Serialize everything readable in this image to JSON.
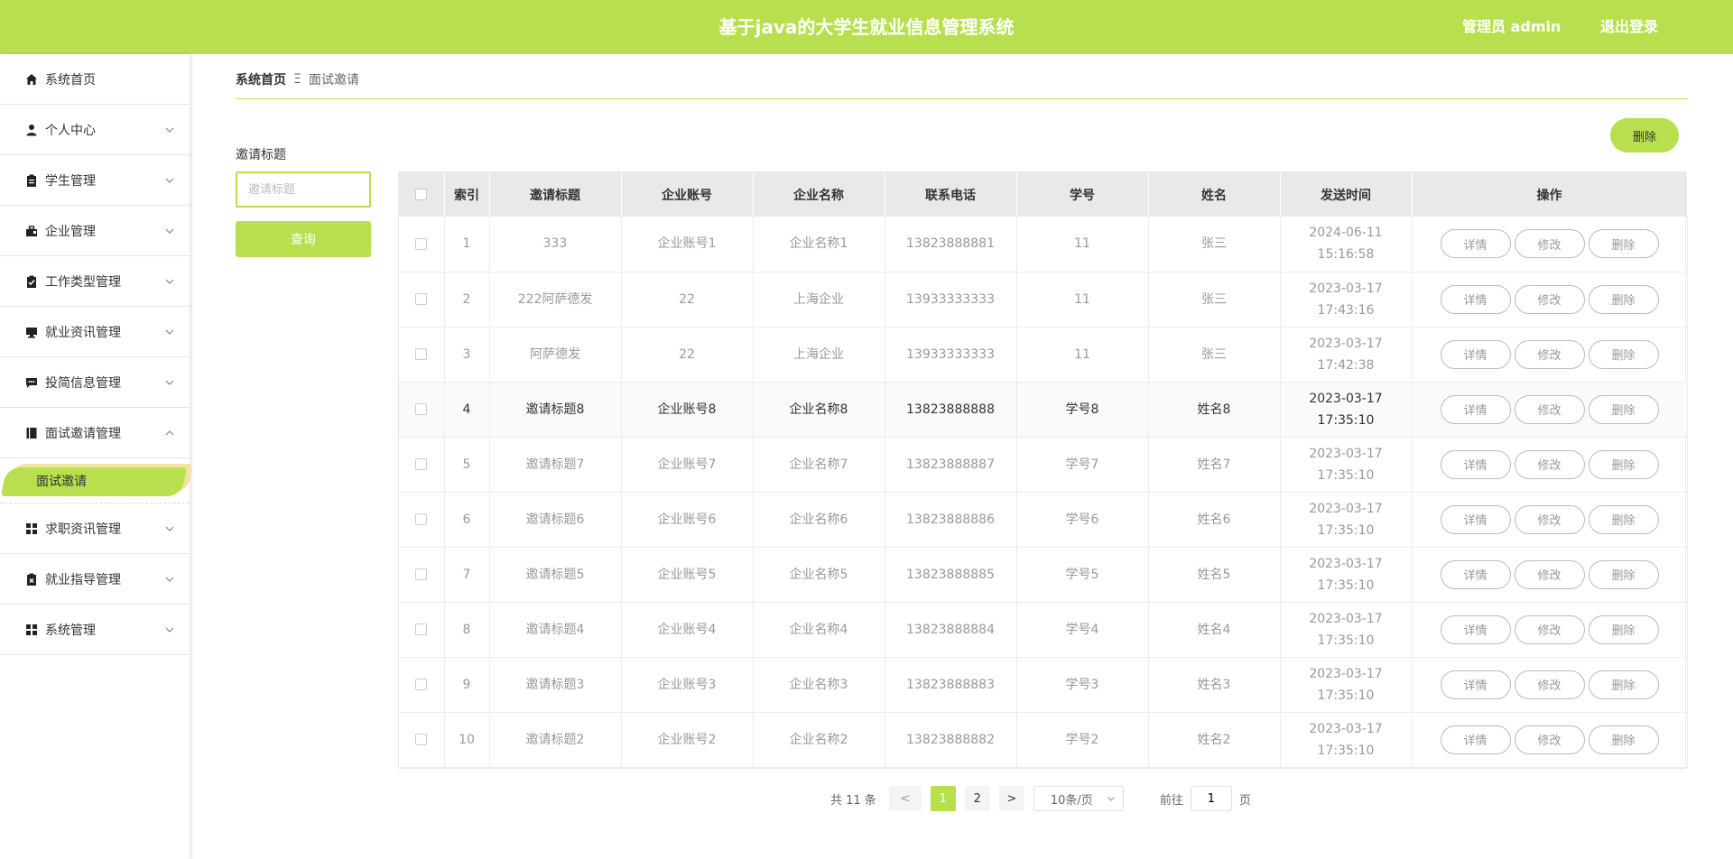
{
  "header": {
    "title": "基于java的大学生就业信息管理系统",
    "user": "管理员 admin",
    "logout": "退出登录"
  },
  "sidebar": {
    "items": [
      {
        "label": "系统首页",
        "icon": "home-icon"
      },
      {
        "label": "个人中心",
        "icon": "user-icon"
      },
      {
        "label": "学生管理",
        "icon": "clipboard-icon"
      },
      {
        "label": "企业管理",
        "icon": "briefcase-icon"
      },
      {
        "label": "工作类型管理",
        "icon": "checklist-icon"
      },
      {
        "label": "就业资讯管理",
        "icon": "monitor-icon"
      },
      {
        "label": "投简信息管理",
        "icon": "chat-icon"
      },
      {
        "label": "面试邀请管理",
        "icon": "book-icon"
      },
      {
        "label": "求职资讯管理",
        "icon": "grid-icon"
      },
      {
        "label": "就业指导管理",
        "icon": "clipboard-x-icon"
      },
      {
        "label": "系统管理",
        "icon": "grid-icon"
      }
    ],
    "active_sub": "面试邀请"
  },
  "breadcrumb": {
    "home": "系统首页",
    "sep": "Ξ",
    "current": "面试邀请"
  },
  "filter": {
    "label": "邀请标题",
    "placeholder": "邀请标题",
    "query": "查询"
  },
  "actions": {
    "delete": "删除"
  },
  "table": {
    "headers": [
      "索引",
      "邀请标题",
      "企业账号",
      "企业名称",
      "联系电话",
      "学号",
      "姓名",
      "发送时间",
      "操作"
    ],
    "op_labels": [
      "详情",
      "修改",
      "删除"
    ],
    "rows": [
      [
        "1",
        "333",
        "企业账号1",
        "企业名称1",
        "13823888881",
        "11",
        "张三",
        "2024-06-11 15:16:58"
      ],
      [
        "2",
        "222阿萨德发",
        "22",
        "上海企业",
        "13933333333",
        "11",
        "张三",
        "2023-03-17 17:43:16"
      ],
      [
        "3",
        "阿萨德发",
        "22",
        "上海企业",
        "13933333333",
        "11",
        "张三",
        "2023-03-17 17:42:38"
      ],
      [
        "4",
        "邀请标题8",
        "企业账号8",
        "企业名称8",
        "13823888888",
        "学号8",
        "姓名8",
        "2023-03-17 17:35:10"
      ],
      [
        "5",
        "邀请标题7",
        "企业账号7",
        "企业名称7",
        "13823888887",
        "学号7",
        "姓名7",
        "2023-03-17 17:35:10"
      ],
      [
        "6",
        "邀请标题6",
        "企业账号6",
        "企业名称6",
        "13823888886",
        "学号6",
        "姓名6",
        "2023-03-17 17:35:10"
      ],
      [
        "7",
        "邀请标题5",
        "企业账号5",
        "企业名称5",
        "13823888885",
        "学号5",
        "姓名5",
        "2023-03-17 17:35:10"
      ],
      [
        "8",
        "邀请标题4",
        "企业账号4",
        "企业名称4",
        "13823888884",
        "学号4",
        "姓名4",
        "2023-03-17 17:35:10"
      ],
      [
        "9",
        "邀请标题3",
        "企业账号3",
        "企业名称3",
        "13823888883",
        "学号3",
        "姓名3",
        "2023-03-17 17:35:10"
      ],
      [
        "10",
        "邀请标题2",
        "企业账号2",
        "企业名称2",
        "13823888882",
        "学号2",
        "姓名2",
        "2023-03-17 17:35:10"
      ]
    ],
    "highlight_row": 4
  },
  "pagination": {
    "total": "共 11 条",
    "prev": "<",
    "pages": [
      "1",
      "2"
    ],
    "current": "1",
    "next": ">",
    "page_size": "10条/页",
    "goto_label": "前往",
    "goto_value": "1",
    "goto_suffix": "页"
  },
  "colors": {
    "accent": "#b8df4e"
  }
}
